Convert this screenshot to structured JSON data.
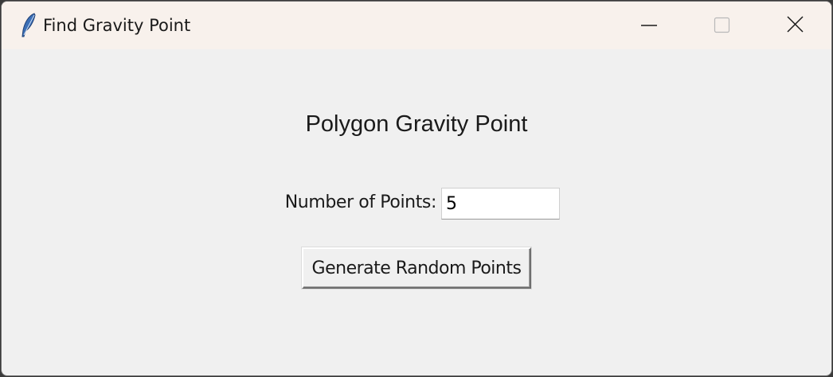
{
  "window": {
    "title": "Find Gravity Point",
    "icon": "feather-icon",
    "controls": [
      "minimize-icon",
      "maximize-icon",
      "close-icon"
    ]
  },
  "main": {
    "heading": "Polygon Gravity Point",
    "points_label": "Number of Points:",
    "points_value": "5",
    "generate_button_label": "Generate Random Points"
  },
  "colors": {
    "titlebar_bg": "#f8f1ec",
    "window_bg": "#f0f0f0",
    "text": "#1a1a1a"
  }
}
